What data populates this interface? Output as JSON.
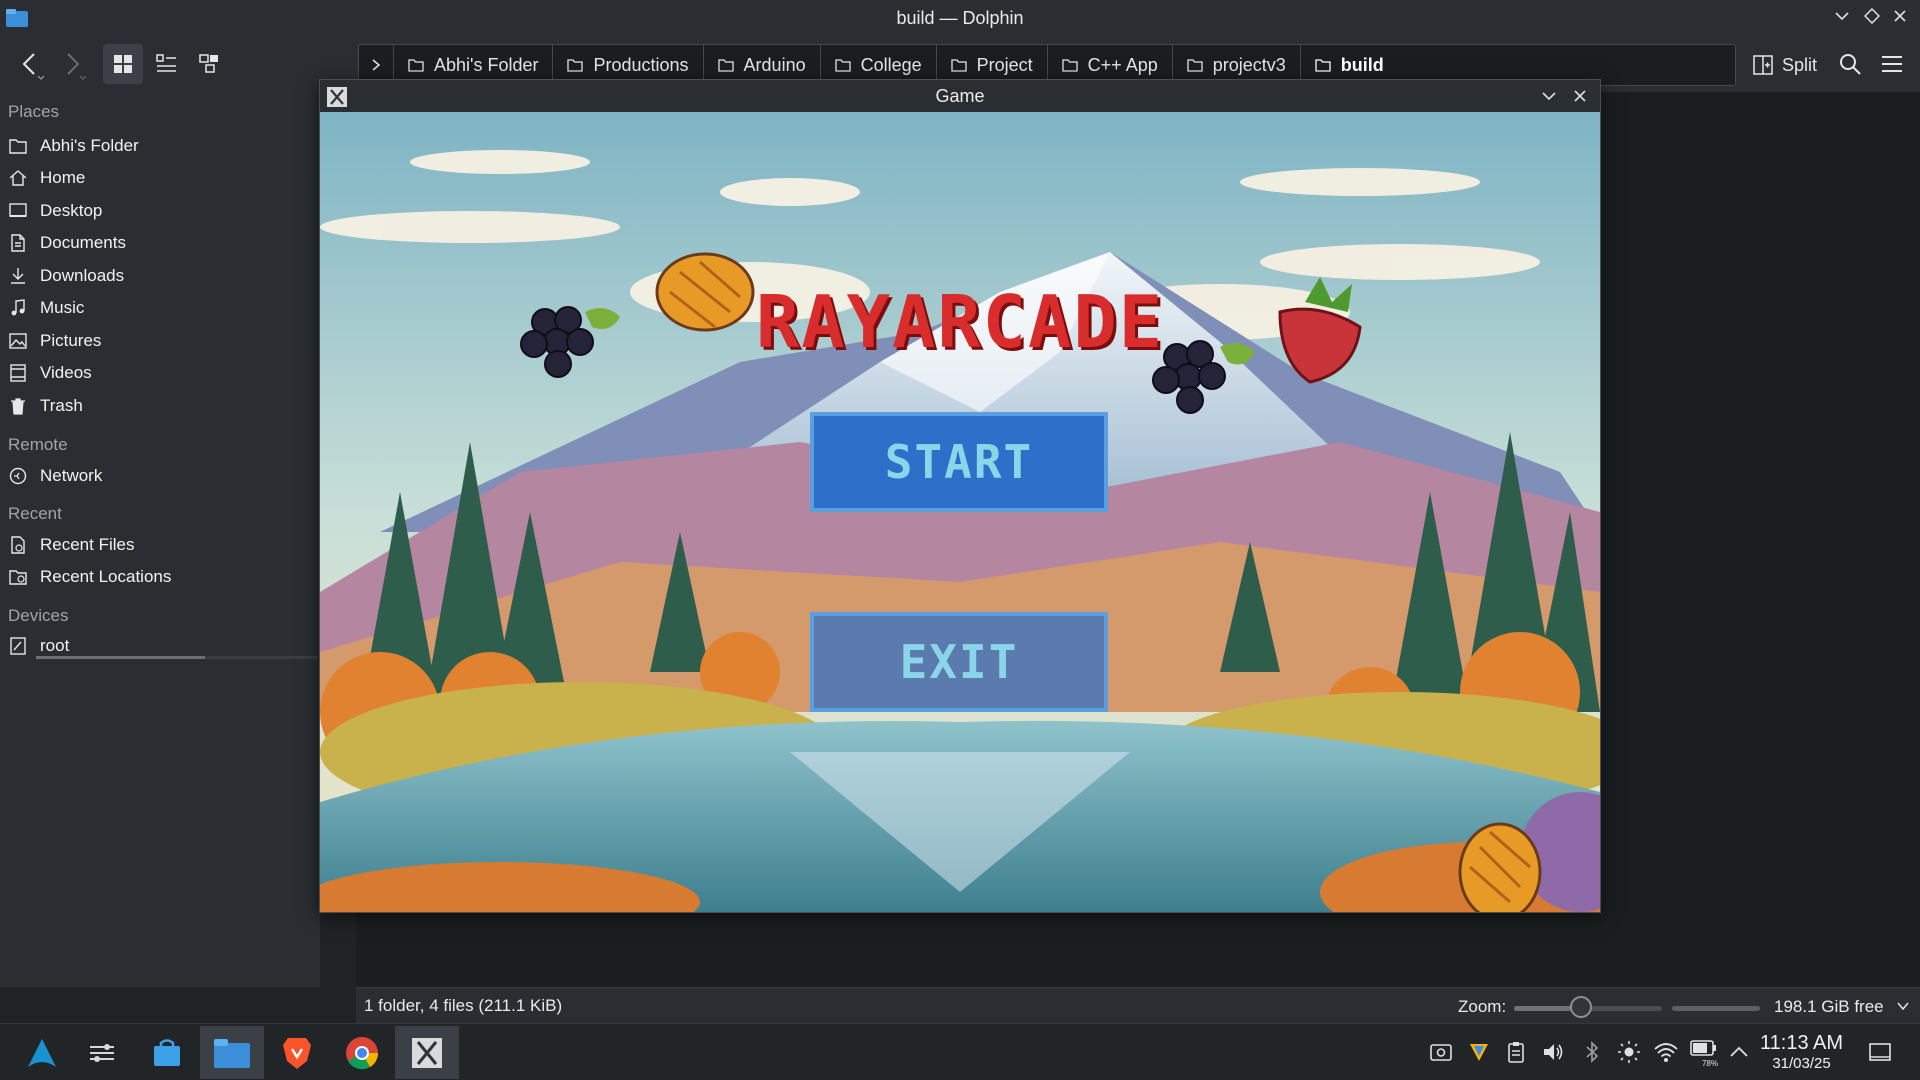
{
  "window": {
    "title": "build — Dolphin"
  },
  "breadcrumb": [
    {
      "label": "Abhi's Folder"
    },
    {
      "label": "Productions"
    },
    {
      "label": "Arduino"
    },
    {
      "label": "College"
    },
    {
      "label": "Project"
    },
    {
      "label": "C++ App"
    },
    {
      "label": "projectv3"
    },
    {
      "label": "build"
    }
  ],
  "toolbar": {
    "split_label": "Split"
  },
  "sidebar": {
    "places_heading": "Places",
    "places": [
      {
        "label": "Abhi's Folder",
        "icon": "folder-icon"
      },
      {
        "label": "Home",
        "icon": "home-icon"
      },
      {
        "label": "Desktop",
        "icon": "desktop-icon"
      },
      {
        "label": "Documents",
        "icon": "documents-icon"
      },
      {
        "label": "Downloads",
        "icon": "download-icon"
      },
      {
        "label": "Music",
        "icon": "music-icon"
      },
      {
        "label": "Pictures",
        "icon": "pictures-icon"
      },
      {
        "label": "Videos",
        "icon": "videos-icon"
      },
      {
        "label": "Trash",
        "icon": "trash-icon"
      }
    ],
    "remote_heading": "Remote",
    "remote": [
      {
        "label": "Network",
        "icon": "network-icon"
      }
    ],
    "recent_heading": "Recent",
    "recent": [
      {
        "label": "Recent Files",
        "icon": "recent-files-icon"
      },
      {
        "label": "Recent Locations",
        "icon": "recent-locations-icon"
      }
    ],
    "devices_heading": "Devices",
    "devices": [
      {
        "label": "root",
        "icon": "drive-icon"
      }
    ],
    "root_usage_fraction": 0.6
  },
  "statusbar": {
    "summary": "1 folder, 4 files (211.1 KiB)",
    "zoom_label": "Zoom:",
    "zoom_fraction": 0.45,
    "free_space": "198.1 GiB free"
  },
  "game": {
    "window_title": "Game",
    "title": "RAYARCADE",
    "start_label": "START",
    "exit_label": "EXIT"
  },
  "taskbar": {
    "time": "11:13 AM",
    "date": "31/03/25",
    "battery": "78%"
  },
  "colors": {
    "accent": "#3daee9",
    "game_title": "#d92c2c",
    "game_button": "#2d6fc9"
  }
}
